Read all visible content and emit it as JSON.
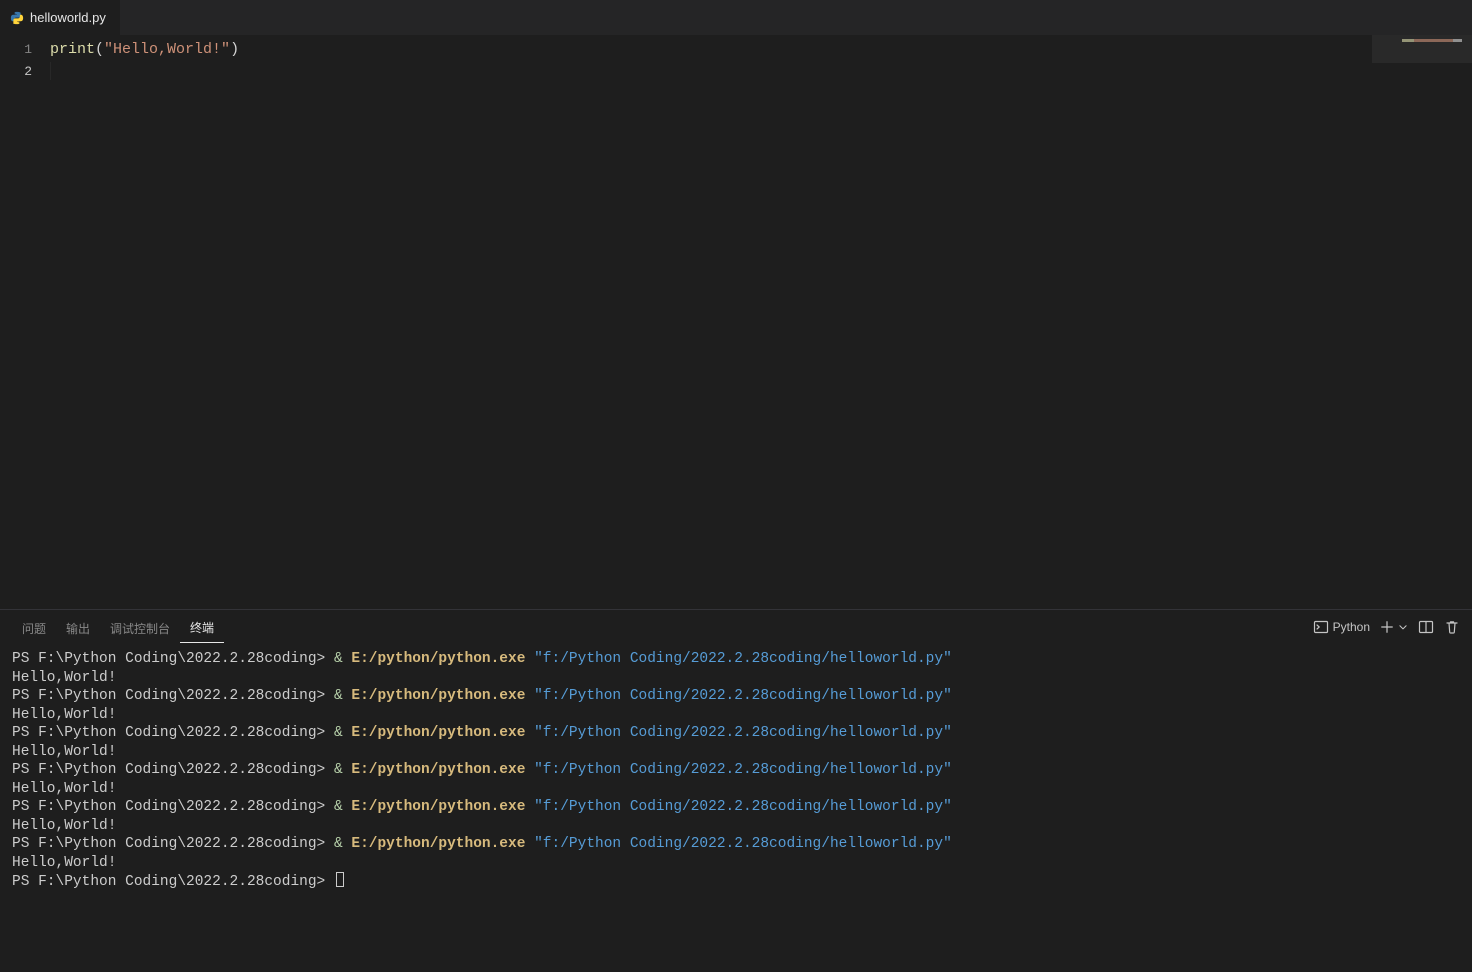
{
  "tab": {
    "filename": "helloworld.py"
  },
  "editor": {
    "line_numbers": [
      "1",
      "2"
    ],
    "code": {
      "fn": "print",
      "open": "(",
      "string": "\"Hello,World!\"",
      "close": ")"
    }
  },
  "panel": {
    "tabs": {
      "problems": "问题",
      "output": "输出",
      "debug": "调试控制台",
      "terminal": "终端"
    },
    "actions": {
      "shell_label": "Python"
    }
  },
  "terminal": {
    "prompt": "PS F:\\Python Coding\\2022.2.28coding>",
    "amp": "&",
    "exe": "E:/python/python.exe",
    "script": "\"f:/Python Coding/2022.2.28coding/helloworld.py\"",
    "output": "Hello,World!",
    "run_count": 6
  }
}
